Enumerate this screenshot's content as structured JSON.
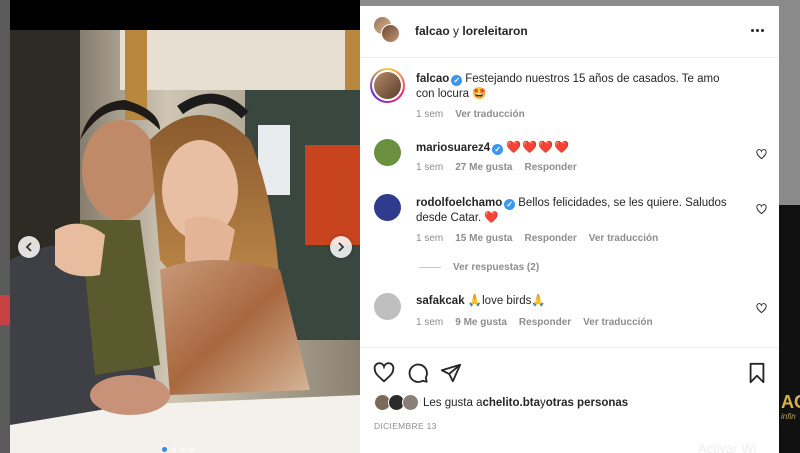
{
  "post": {
    "header": {
      "author": "falcao",
      "connector": " y ",
      "coauthor": "loreleitaron"
    },
    "caption": {
      "user": "falcao",
      "text": "Festejando nuestros 15 años de casados. Te amo con locura 🤩",
      "time": "1 sem",
      "see_translation": "Ver traducción"
    },
    "comments": [
      {
        "user": "mariosuarez4",
        "text": "❤️❤️❤️❤️",
        "time": "1 sem",
        "likes": "27 Me gusta",
        "reply": "Responder",
        "avatar_color": "#6a8f3e"
      },
      {
        "user": "rodolfoelchamo",
        "text": "Bellos felicidades, se les quiere. Saludos desde Catar. ❤️",
        "time": "1 sem",
        "likes": "15 Me gusta",
        "reply": "Responder",
        "see_translation": "Ver traducción",
        "avatar_color": "#2f3b8c",
        "view_replies": "Ver respuestas (2)"
      },
      {
        "user": "safakcak",
        "text": "🙏love birds🙏",
        "time": "1 sem",
        "likes": "9 Me gusta",
        "reply": "Responder",
        "see_translation": "Ver traducción",
        "avatar_color": "#bfbfbf"
      }
    ],
    "likes_text": {
      "prefix": "Les gusta a ",
      "user": "chelito.bta",
      "middle": " y ",
      "others": "otras personas"
    },
    "date": "DICIEMBRE 13"
  },
  "background": {
    "right_logo_text": "AC",
    "right_logo_sub": "infin",
    "activate_text": "Activar Wi"
  },
  "icons": {
    "more": "more-horizontal-icon",
    "like": "heart-outline-icon",
    "comment": "comment-bubble-icon",
    "share": "paper-plane-icon",
    "save": "bookmark-icon",
    "prev": "chevron-left-icon",
    "next": "chevron-right-icon"
  },
  "colors": {
    "verified": "#3897f0",
    "muted": "#8e8e8e",
    "heart": "#ed1c24"
  }
}
